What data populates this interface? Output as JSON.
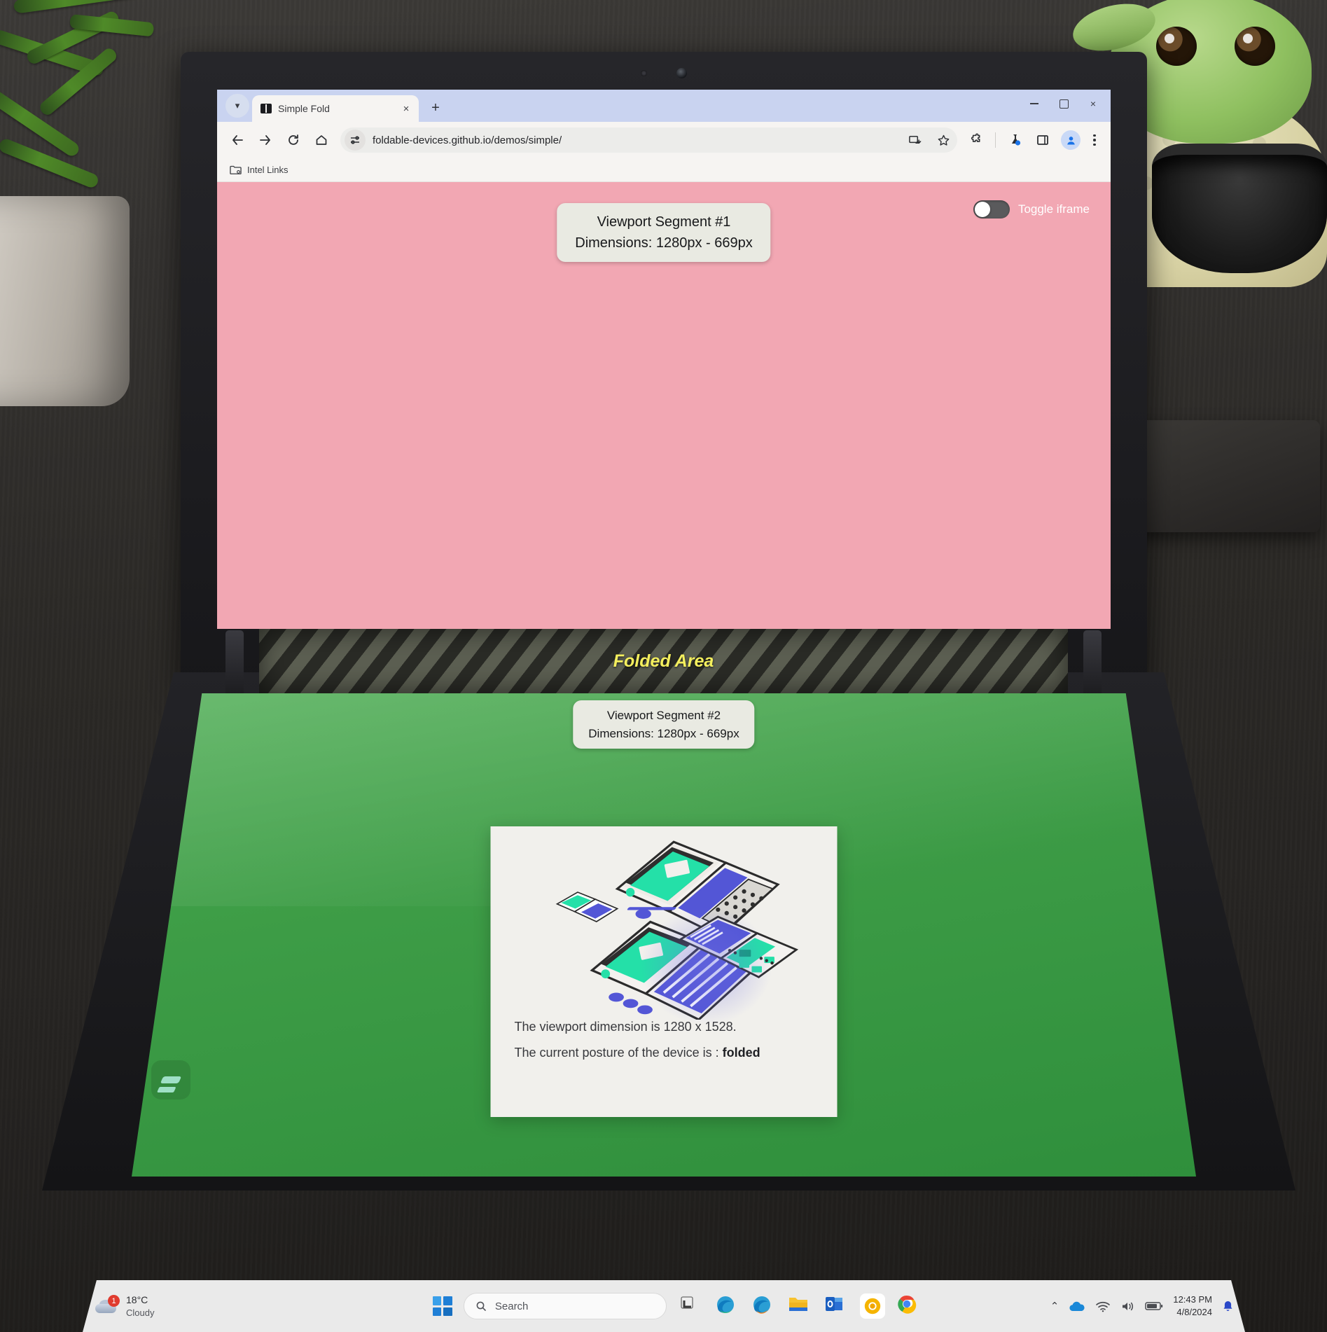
{
  "browser": {
    "tab": {
      "title": "Simple Fold",
      "close_label": "×"
    },
    "new_tab_label": "+",
    "window_controls": {
      "minimize": "",
      "maximize": "",
      "close": "×"
    },
    "nav": {
      "back": "←",
      "forward": "→",
      "reload": "↻",
      "home": "⌂"
    },
    "omnibox": {
      "url": "foldable-devices.github.io/demos/simple/"
    },
    "toolbar_icons": [
      "install-app-icon",
      "bookmark-star-icon",
      "extensions-puzzle-icon",
      "lab-flask-icon",
      "side-panel-icon",
      "profile-avatar-icon",
      "chrome-menu-icon"
    ],
    "bookmarks": [
      {
        "label": "Intel Links",
        "icon": "folder-gear-icon"
      }
    ]
  },
  "page": {
    "segment1": {
      "title": "Viewport Segment #1",
      "dimensions": "Dimensions: 1280px - 669px",
      "background_color": "#f2a7b3"
    },
    "toggle": {
      "label": "Toggle iframe",
      "state": "off"
    },
    "folded_area": {
      "label": "Folded Area",
      "text_color": "#f4ef5e"
    },
    "segment2": {
      "title": "Viewport Segment #2",
      "dimensions": "Dimensions: 1280px - 669px",
      "background_color": "#3d9c46"
    },
    "info_card": {
      "viewport_line": "The viewport dimension is 1280 x 1528.",
      "posture_prefix": "The current posture of the device is : ",
      "posture_value": "folded",
      "illustration": "foldable-laptops-isometric-illustration"
    }
  },
  "taskbar": {
    "weather": {
      "temperature": "18°C",
      "condition": "Cloudy",
      "badge": "1"
    },
    "search": {
      "placeholder": "Search"
    },
    "apps": [
      "task-view-icon",
      "edge-icon",
      "edge-beta-icon",
      "file-explorer-icon",
      "outlook-icon",
      "chrome-canary-icon",
      "chrome-icon"
    ],
    "tray": {
      "overflow": "⌃",
      "icons": [
        "onedrive-icon",
        "wifi-icon",
        "volume-icon",
        "battery-icon",
        "notification-bell-icon"
      ],
      "time": "12:43 PM",
      "date": "4/8/2024"
    }
  }
}
